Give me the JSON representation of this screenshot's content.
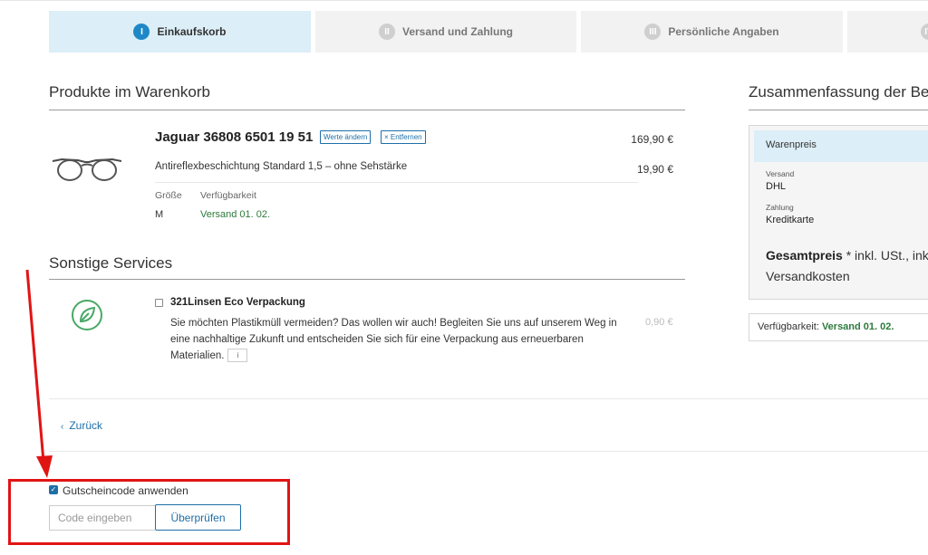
{
  "steps": [
    {
      "number": "I",
      "label": "Einkaufskorb"
    },
    {
      "number": "II",
      "label": "Versand und Zahlung"
    },
    {
      "number": "III",
      "label": "Persönliche Angaben"
    },
    {
      "number": "IV",
      "label": ""
    }
  ],
  "cart": {
    "heading": "Produkte im Warenkorb",
    "product": {
      "title": "Jaguar 36808 6501 19 51",
      "edit_label": "Werte ändern",
      "remove_label": "× Entfernen",
      "price": "169,90 €",
      "option": "Antireflexbeschichtung Standard 1,5 – ohne Sehstärke",
      "option_price": "19,90 €",
      "size_label": "Größe",
      "size_value": "M",
      "availability_label": "Verfügbarkeit",
      "availability_value": "Versand 01. 02."
    }
  },
  "services": {
    "heading": "Sonstige Services",
    "item": {
      "title": "321Linsen Eco Verpackung",
      "description": "Sie möchten Plastikmüll vermeiden? Das wollen wir auch! Begleiten Sie uns auf unserem Weg in eine nachhaltige Zukunft und entscheiden Sie sich für eine Verpackung aus erneuerbaren Materialien.",
      "info_label": "i",
      "price": "0,90 €"
    }
  },
  "back_link": "Zurück",
  "voucher": {
    "label": "Gutscheincode anwenden",
    "placeholder": "Code eingeben",
    "button": "Überprüfen",
    "checked": true
  },
  "summary": {
    "heading": "Zusammenfassung der Bes",
    "head_row": "Warenpreis",
    "shipping_label": "Versand",
    "shipping_value": "DHL",
    "payment_label": "Zahlung",
    "payment_value": "Kreditkarte",
    "total_bold": "Gesamtpreis",
    "total_rest": " * inkl. USt., inkl. Versandkosten",
    "availability_label": "Verfügbarkeit: ",
    "availability_value": "Versand 01. 02."
  },
  "colors": {
    "accent": "#1e6fa8",
    "annotation": "#e11414",
    "active_step": "#dceef7",
    "availability_green": "#2d7a3a"
  }
}
